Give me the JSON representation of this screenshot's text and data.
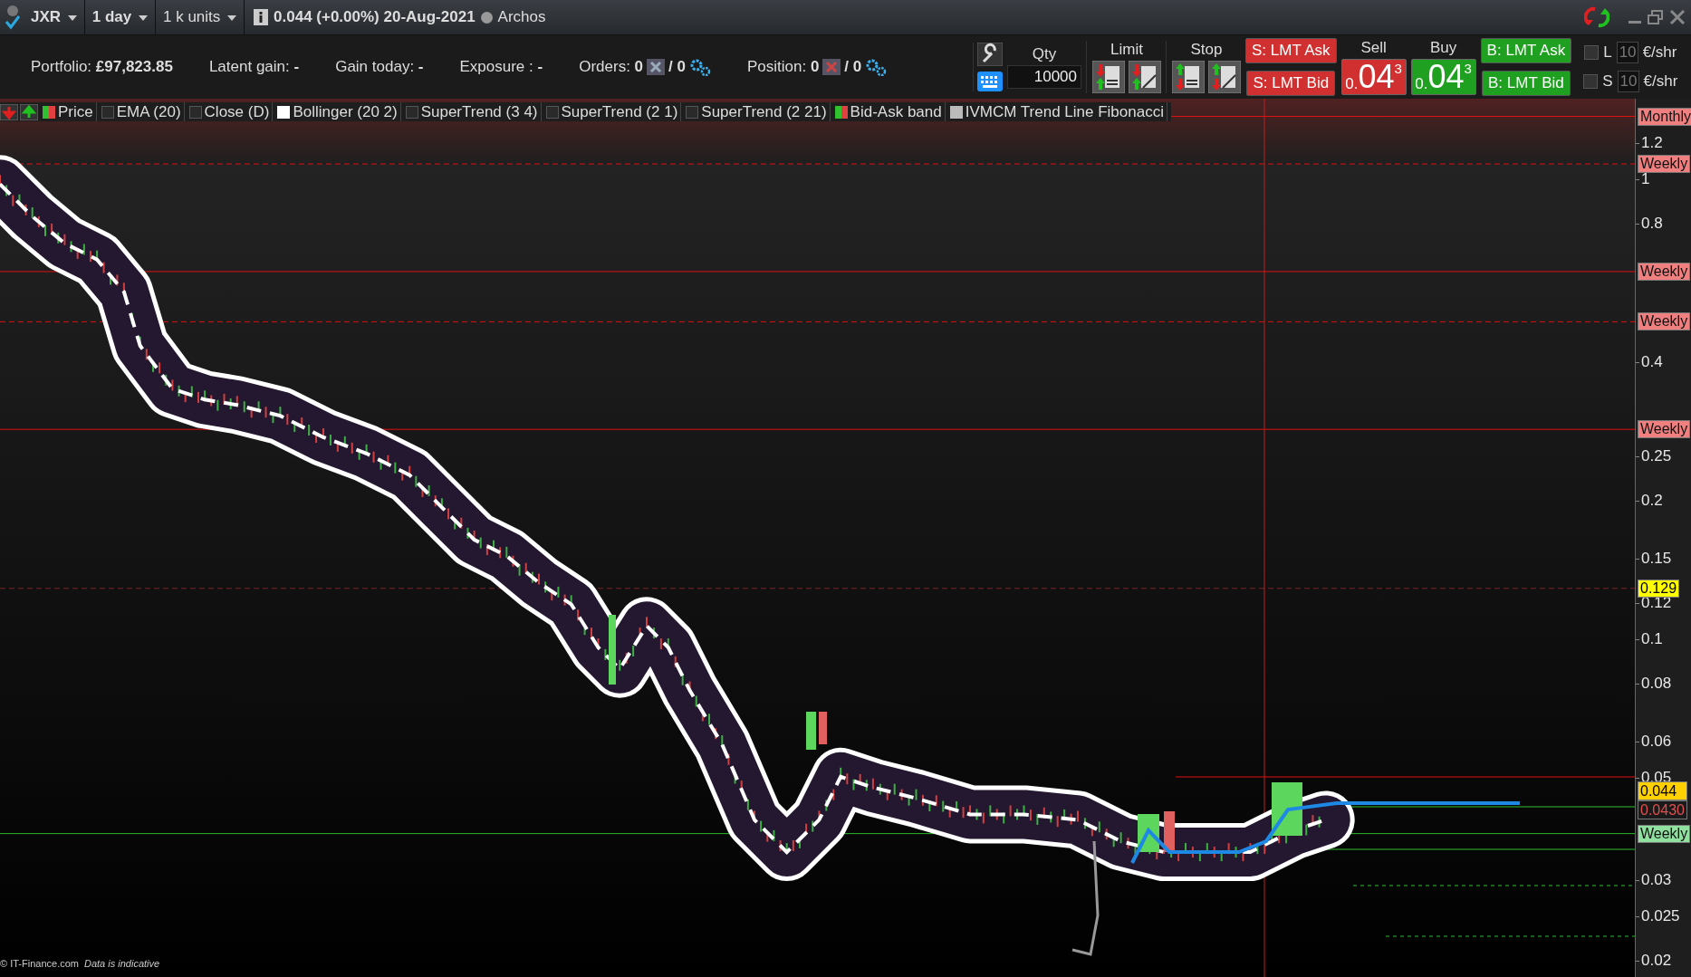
{
  "title_bar": {
    "symbol": "JXR",
    "period": "1 day",
    "units": "1 k units",
    "quote": "0.044 (+0.00%) 20-Aug-2021",
    "name": "Archos"
  },
  "account": {
    "portfolio_label": "Portfolio:",
    "portfolio_value": "£97,823.85",
    "latent_label": "Latent gain:",
    "latent_value": "-",
    "gain_label": "Gain today:",
    "gain_value": "-",
    "exposure_label": "Exposure :",
    "exposure_value": "-",
    "orders_label": "Orders:",
    "orders_count": "0",
    "orders_sep": "/ 0",
    "position_label": "Position:",
    "position_count": "0",
    "position_sep": "/ 0"
  },
  "order_panel": {
    "qty_label": "Qty",
    "qty_value": "10000",
    "limit_label": "Limit",
    "stop_label": "Stop",
    "sell_ask": "S: LMT Ask",
    "sell_bid": "S: LMT Bid",
    "sell_label": "Sell",
    "sell_price": {
      "prefix": "0.",
      "main": "04",
      "sup": "3"
    },
    "buy_label": "Buy",
    "buy_price": {
      "prefix": "0.",
      "main": "04",
      "sup": "3"
    },
    "buy_ask": "B: LMT Ask",
    "buy_bid": "B: LMT Bid",
    "offsets": [
      {
        "label": "L",
        "checked": false,
        "value": "10",
        "unit": "€/shr"
      },
      {
        "label": "S",
        "checked": false,
        "value": "10",
        "unit": "€/shr"
      }
    ]
  },
  "legend": [
    {
      "label": "Price",
      "kind": "bicolor"
    },
    {
      "label": "EMA (20)",
      "kind": "empty"
    },
    {
      "label": "Close (D)",
      "kind": "empty"
    },
    {
      "label": "Bollinger (20 2)",
      "kind": "white"
    },
    {
      "label": "SuperTrend (3 4)",
      "kind": "empty"
    },
    {
      "label": "SuperTrend (2 1)",
      "kind": "empty"
    },
    {
      "label": "SuperTrend (2 21)",
      "kind": "empty"
    },
    {
      "label": "Bid-Ask band",
      "kind": "bicolor"
    },
    {
      "label": "IVMCM Trend Line Fibonacci",
      "kind": "grey"
    }
  ],
  "price_axis": {
    "ticks": [
      "1.2",
      "1",
      "0.8",
      "0.4",
      "0.25",
      "0.2",
      "0.15",
      "0.12",
      "0.1",
      "0.08",
      "0.06",
      "0.05",
      "0.03",
      "0.025",
      "0.02"
    ],
    "tags": [
      {
        "label": "Monthly",
        "kind": "level",
        "color": "#f08080"
      },
      {
        "label": "Weekly",
        "kind": "level",
        "color": "#f08080"
      },
      {
        "label": "Weekly",
        "kind": "level",
        "color": "#f08080"
      },
      {
        "label": "Weekly",
        "kind": "level",
        "color": "#f08080"
      },
      {
        "label": "Weekly",
        "kind": "level",
        "color": "#f08080"
      },
      {
        "label": "0.129",
        "kind": "cursor",
        "color": "#ffff00"
      },
      {
        "label": "Weekly",
        "kind": "level",
        "color": "#90e0a0"
      }
    ],
    "price_tags": [
      {
        "label": "0.044",
        "kind": "last",
        "color": "#ffd000"
      },
      {
        "label": "0.0430",
        "kind": "bid",
        "color": "#1a1a1a"
      }
    ]
  },
  "footer": {
    "source": "© IT-Finance.com",
    "note": "Data is indicative"
  }
}
